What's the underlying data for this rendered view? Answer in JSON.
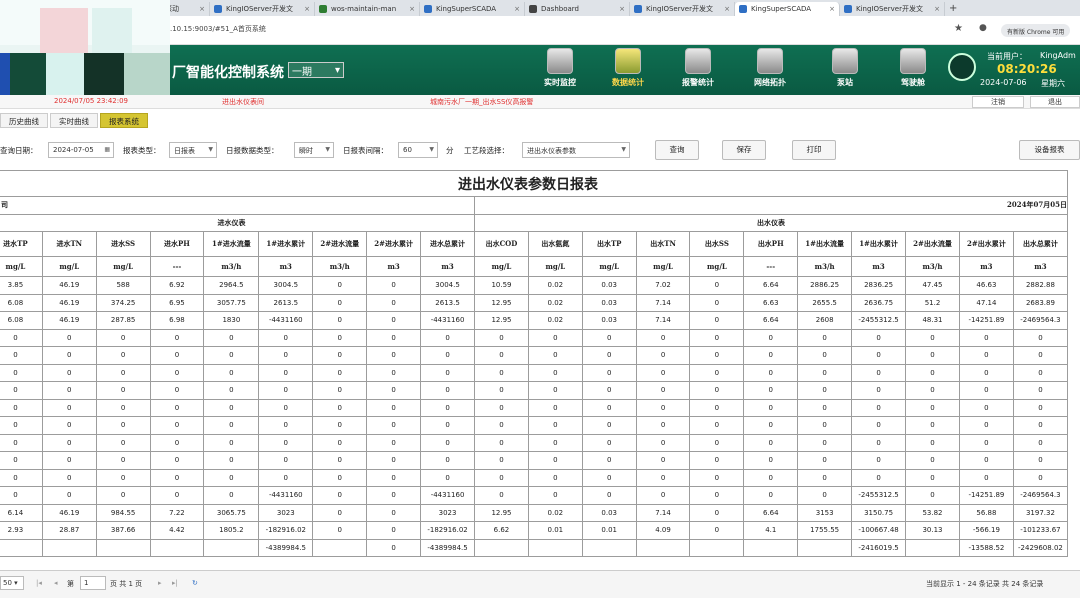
{
  "browser": {
    "tabs": [
      {
        "label": "KingSuperSCADA",
        "color": "#2f6fc4"
      },
      {
        "label": "html如何设置滚动",
        "color": "#c0392b"
      },
      {
        "label": "KingIOServer开发文",
        "color": "#2f6fc4"
      },
      {
        "label": "wos-maintain-man",
        "color": "#2e7d32"
      },
      {
        "label": "KingSuperSCADA",
        "color": "#2f6fc4"
      },
      {
        "label": "Dashboard",
        "color": "#444444"
      },
      {
        "label": "KingIOServer开发文",
        "color": "#2f6fc4"
      },
      {
        "label": "KingSuperSCADA",
        "color": "#2f6fc4"
      },
      {
        "label": "KingIOServer开发文",
        "color": "#2f6fc4"
      }
    ],
    "url": ".10.15:9003/#51_A首页系统",
    "chrome_chip": "有新版 Chrome 可用"
  },
  "header": {
    "system_title": "厂智能化控制系统",
    "phase": "一期",
    "nav": [
      {
        "label": "实时监控"
      },
      {
        "label": "数据统计"
      },
      {
        "label": "报警统计"
      },
      {
        "label": "网络拓扑"
      },
      {
        "label": "泵站"
      },
      {
        "label": "驾驶舱"
      }
    ],
    "user_label": "当前用户：",
    "user_name": "KingAdm",
    "clock": "08:20:26",
    "date": "2024-07-06",
    "weekday": "星期六"
  },
  "alarm": {
    "time": "2024/07/05 23:42:09",
    "type": "进出水仪表间",
    "message": "城南污水厂一期_出水SS仪高报警",
    "logout": "注销",
    "exit": "退出"
  },
  "subtabs": [
    "历史曲线",
    "实时曲线",
    "报表系统"
  ],
  "filters": {
    "date_label": "查询日期：",
    "date_value": "2024-07-05",
    "type_label": "报表类型：",
    "type_value": "日报表",
    "datatype_label": "日报数据类型：",
    "datatype_value": "瞬时",
    "interval_label": "日报表间隔：",
    "interval_value": "60",
    "interval_unit": "分",
    "section_label": "工艺段选择：",
    "section_value": "进出水仪表参数",
    "query": "查询",
    "save": "保存",
    "print": "打印",
    "device_report": "设备报表"
  },
  "report": {
    "title": "进出水仪表参数日报表",
    "company": "司",
    "report_date": "2024年07月05日",
    "in_group": "进水仪表",
    "out_group": "出水仪表",
    "columns": [
      "进水TP",
      "进水TN",
      "进水SS",
      "进水PH",
      "1#进水流量",
      "1#进水累计",
      "2#进水流量",
      "2#进水累计",
      "进水总累计",
      "出水COD",
      "出水氨氮",
      "出水TP",
      "出水TN",
      "出水SS",
      "出水PH",
      "1#出水流量",
      "1#出水累计",
      "2#出水流量",
      "2#出水累计",
      "出水总累计"
    ],
    "units": [
      "mg/L",
      "mg/L",
      "mg/L",
      "---",
      "m3/h",
      "m3",
      "m3/h",
      "m3",
      "m3",
      "mg/L",
      "mg/L",
      "mg/L",
      "mg/L",
      "mg/L",
      "---",
      "m3/h",
      "m3",
      "m3/h",
      "m3",
      "m3"
    ],
    "rows": [
      [
        "3.85",
        "46.19",
        "588",
        "6.92",
        "2964.5",
        "3004.5",
        "0",
        "0",
        "3004.5",
        "10.59",
        "0.02",
        "0.03",
        "7.02",
        "0",
        "6.64",
        "2886.25",
        "2836.25",
        "47.45",
        "46.63",
        "2882.88"
      ],
      [
        "6.08",
        "46.19",
        "374.25",
        "6.95",
        "3057.75",
        "2613.5",
        "0",
        "0",
        "2613.5",
        "12.95",
        "0.02",
        "0.03",
        "7.14",
        "0",
        "6.63",
        "2655.5",
        "2636.75",
        "51.2",
        "47.14",
        "2683.89"
      ],
      [
        "6.08",
        "46.19",
        "287.85",
        "6.98",
        "1830",
        "-4431160",
        "0",
        "0",
        "-4431160",
        "12.95",
        "0.02",
        "0.03",
        "7.14",
        "0",
        "6.64",
        "2608",
        "-2455312.5",
        "48.31",
        "-14251.89",
        "-2469564.3"
      ],
      [
        "0",
        "0",
        "0",
        "0",
        "0",
        "0",
        "0",
        "0",
        "0",
        "0",
        "0",
        "0",
        "0",
        "0",
        "0",
        "0",
        "0",
        "0",
        "0",
        "0"
      ],
      [
        "0",
        "0",
        "0",
        "0",
        "0",
        "0",
        "0",
        "0",
        "0",
        "0",
        "0",
        "0",
        "0",
        "0",
        "0",
        "0",
        "0",
        "0",
        "0",
        "0"
      ],
      [
        "0",
        "0",
        "0",
        "0",
        "0",
        "0",
        "0",
        "0",
        "0",
        "0",
        "0",
        "0",
        "0",
        "0",
        "0",
        "0",
        "0",
        "0",
        "0",
        "0"
      ],
      [
        "0",
        "0",
        "0",
        "0",
        "0",
        "0",
        "0",
        "0",
        "0",
        "0",
        "0",
        "0",
        "0",
        "0",
        "0",
        "0",
        "0",
        "0",
        "0",
        "0"
      ],
      [
        "0",
        "0",
        "0",
        "0",
        "0",
        "0",
        "0",
        "0",
        "0",
        "0",
        "0",
        "0",
        "0",
        "0",
        "0",
        "0",
        "0",
        "0",
        "0",
        "0"
      ],
      [
        "0",
        "0",
        "0",
        "0",
        "0",
        "0",
        "0",
        "0",
        "0",
        "0",
        "0",
        "0",
        "0",
        "0",
        "0",
        "0",
        "0",
        "0",
        "0",
        "0"
      ],
      [
        "0",
        "0",
        "0",
        "0",
        "0",
        "0",
        "0",
        "0",
        "0",
        "0",
        "0",
        "0",
        "0",
        "0",
        "0",
        "0",
        "0",
        "0",
        "0",
        "0"
      ],
      [
        "0",
        "0",
        "0",
        "0",
        "0",
        "0",
        "0",
        "0",
        "0",
        "0",
        "0",
        "0",
        "0",
        "0",
        "0",
        "0",
        "0",
        "0",
        "0",
        "0"
      ],
      [
        "0",
        "0",
        "0",
        "0",
        "0",
        "0",
        "0",
        "0",
        "0",
        "0",
        "0",
        "0",
        "0",
        "0",
        "0",
        "0",
        "0",
        "0",
        "0",
        "0"
      ],
      [
        "0",
        "0",
        "0",
        "0",
        "0",
        "-4431160",
        "0",
        "0",
        "-4431160",
        "0",
        "0",
        "0",
        "0",
        "0",
        "0",
        "0",
        "-2455312.5",
        "0",
        "-14251.89",
        "-2469564.3"
      ],
      [
        "6.14",
        "46.19",
        "984.55",
        "7.22",
        "3065.75",
        "3023",
        "0",
        "0",
        "3023",
        "12.95",
        "0.02",
        "0.03",
        "7.14",
        "0",
        "6.64",
        "3153",
        "3150.75",
        "53.82",
        "56.88",
        "3197.32"
      ],
      [
        "2.93",
        "28.87",
        "387.66",
        "4.42",
        "1805.2",
        "-182916.02",
        "0",
        "0",
        "-182916.02",
        "6.62",
        "0.01",
        "0.01",
        "4.09",
        "0",
        "4.1",
        "1755.55",
        "-100667.48",
        "30.13",
        "-566.19",
        "-101233.67"
      ],
      [
        "",
        "",
        "",
        "",
        "",
        "-4389984.5",
        "",
        "0",
        "-4389984.5",
        "",
        "",
        "",
        "",
        "",
        "",
        "",
        "-2416019.5",
        "",
        "-13588.52",
        "-2429608.02"
      ]
    ]
  },
  "pager": {
    "page_size": "50",
    "page_prefix": "第",
    "page": "1",
    "page_suffix": "页 共 1 页",
    "summary": "当前显示 1 - 24 条记录 共 24 条记录"
  }
}
